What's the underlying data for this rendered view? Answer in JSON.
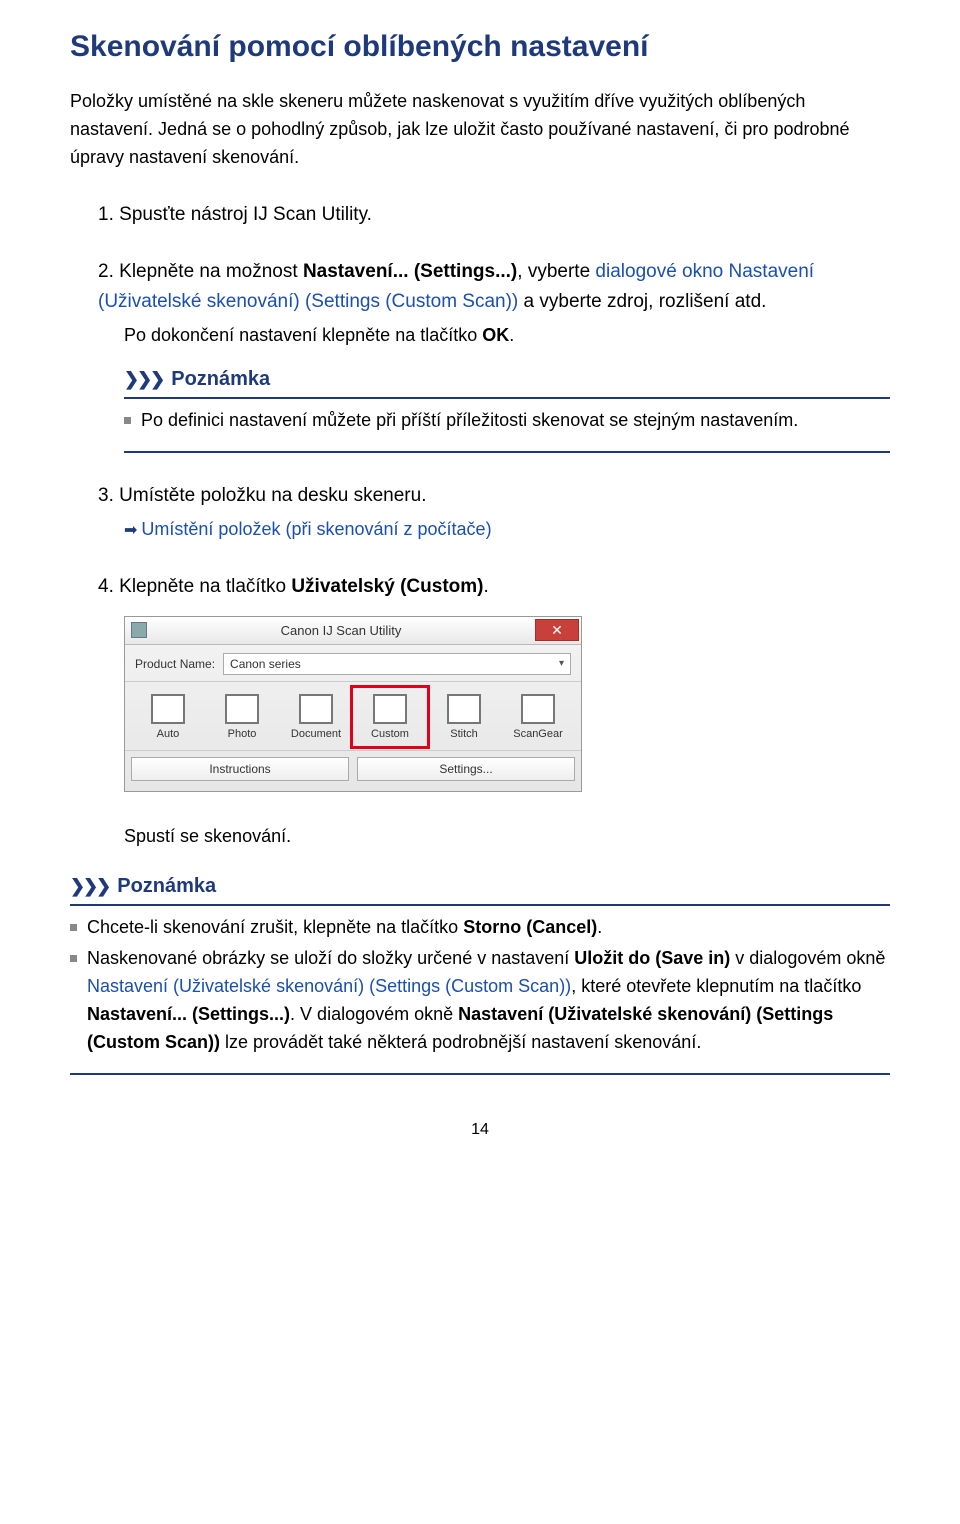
{
  "title": "Skenování pomocí oblíbených nastavení",
  "intro": "Položky umístěné na skle skeneru můžete naskenovat s využitím dříve využitých oblíbených nastavení.\nJedná se o pohodlný způsob, jak lze uložit často používané nastavení, či pro podrobné úpravy nastavení skenování.",
  "steps": {
    "s1": {
      "num": "1.",
      "text": "Spusťte nástroj IJ Scan Utility."
    },
    "s2": {
      "num": "2.",
      "text_a": "Klepněte na možnost ",
      "text_b": "Nastavení... (Settings...)",
      "text_c": ", vyberte ",
      "link1": "dialogové okno Nastavení (Uživatelské skenování) (Settings (Custom Scan))",
      "text_d": " a vyberte zdroj, rozlišení atd.",
      "sub_p1": "Po dokončení nastavení klepněte na tlačítko ",
      "sub_p1_b": "OK",
      "sub_p1_c": "."
    },
    "s3": {
      "num": "3.",
      "text": "Umístěte položku na desku skeneru.",
      "link": "Umístění položek (při skenování z počítače)"
    },
    "s4": {
      "num": "4.",
      "text_a": "Klepněte na tlačítko ",
      "text_b": "Uživatelský (Custom)",
      "text_c": "."
    }
  },
  "note1": {
    "label": "Poznámka",
    "item": "Po definici nastavení můžete při příští příležitosti skenovat se stejným nastavením."
  },
  "app": {
    "title": "Canon IJ Scan Utility",
    "product_label": "Product Name:",
    "product_value": "Canon           series",
    "icons": [
      "Auto",
      "Photo",
      "Document",
      "Custom",
      "Stitch",
      "ScanGear"
    ],
    "btn_instructions": "Instructions",
    "btn_settings": "Settings..."
  },
  "result": "Spustí se skenování.",
  "note2": {
    "label": "Poznámka",
    "item1_a": "Chcete-li skenování zrušit, klepněte na tlačítko ",
    "item1_b": "Storno (Cancel)",
    "item1_c": ".",
    "item2_a": "Naskenované obrázky se uloží do složky určené v nastavení ",
    "item2_b": "Uložit do (Save in)",
    "item2_c": " v dialogovém okně ",
    "item2_link": "Nastavení (Uživatelské skenování) (Settings (Custom Scan))",
    "item2_d": ", které otevřete klepnutím na tlačítko ",
    "item2_e": "Nastavení... (Settings...)",
    "item2_f": ". V dialogovém okně ",
    "item2_g": "Nastavení (Uživatelské skenování) (Settings (Custom Scan))",
    "item2_h": " lze provádět také některá podrobnější nastavení skenování."
  },
  "page_number": "14"
}
